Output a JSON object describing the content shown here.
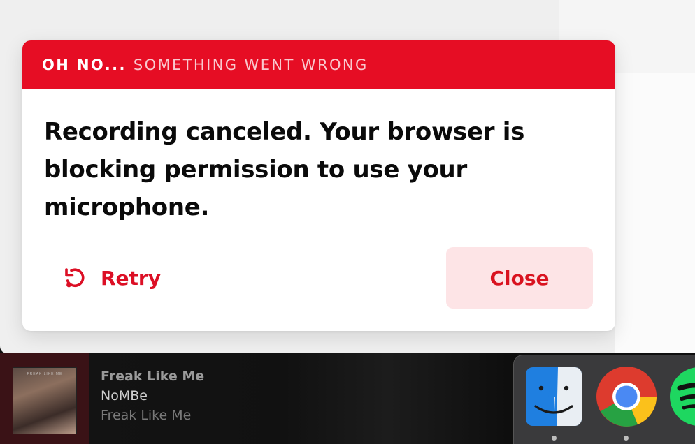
{
  "dialog": {
    "header_strong": "OH NO...",
    "header_light": "SOMETHING WENT WRONG",
    "message": "Recording canceled. Your browser is blocking permission to use your microphone.",
    "retry_label": "Retry",
    "close_label": "Close",
    "accent_color": "#e60d24",
    "retry_icon": "retry-icon"
  },
  "now_playing": {
    "title": "Freak Like Me",
    "artist": "NoMBe",
    "album": "Freak Like Me",
    "art_text": "FREAK LIKE ME"
  },
  "dock": {
    "apps": [
      {
        "name": "Finder",
        "icon": "finder-icon"
      },
      {
        "name": "Google Chrome",
        "icon": "chrome-icon"
      },
      {
        "name": "Spotify",
        "icon": "spotify-icon"
      }
    ]
  }
}
